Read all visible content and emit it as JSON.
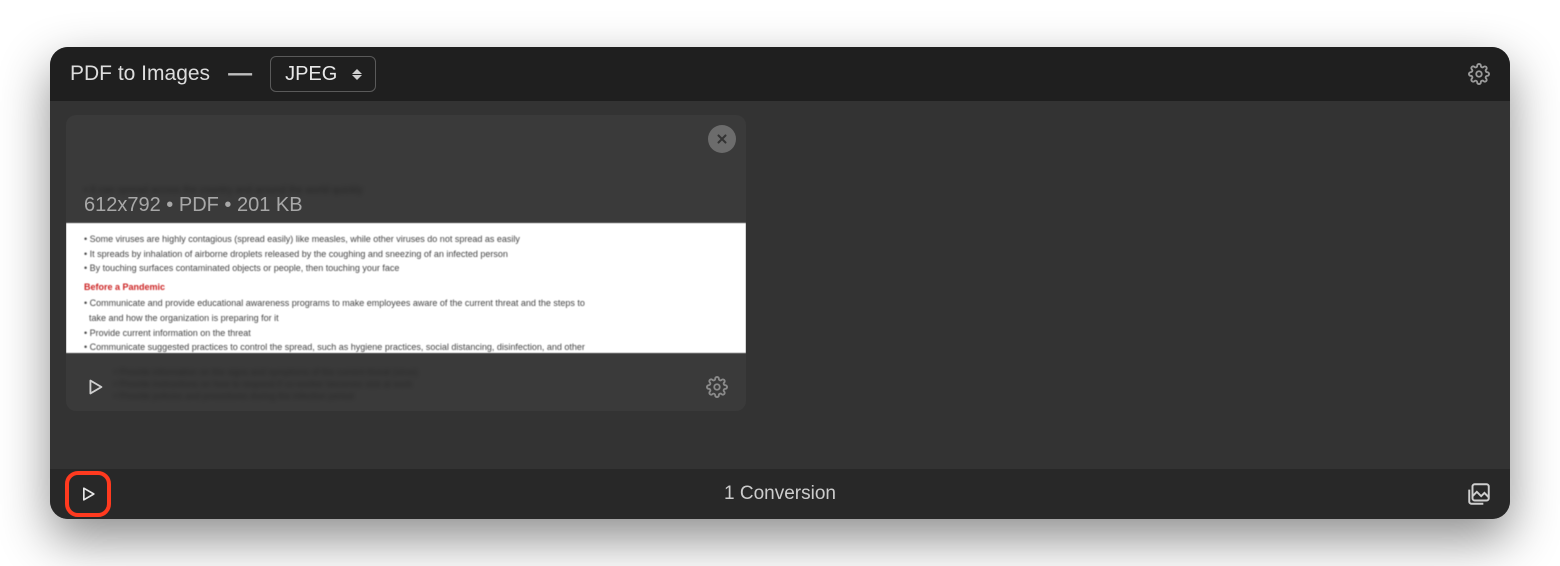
{
  "header": {
    "title": "PDF to Images",
    "separator": "—",
    "format_selected": "JPEG"
  },
  "file": {
    "dimensions": "612x792",
    "type": "PDF",
    "size": "201 KB",
    "info_line": "612x792 • PDF • 201 KB"
  },
  "statusbar": {
    "count_text": "1 Conversion"
  }
}
